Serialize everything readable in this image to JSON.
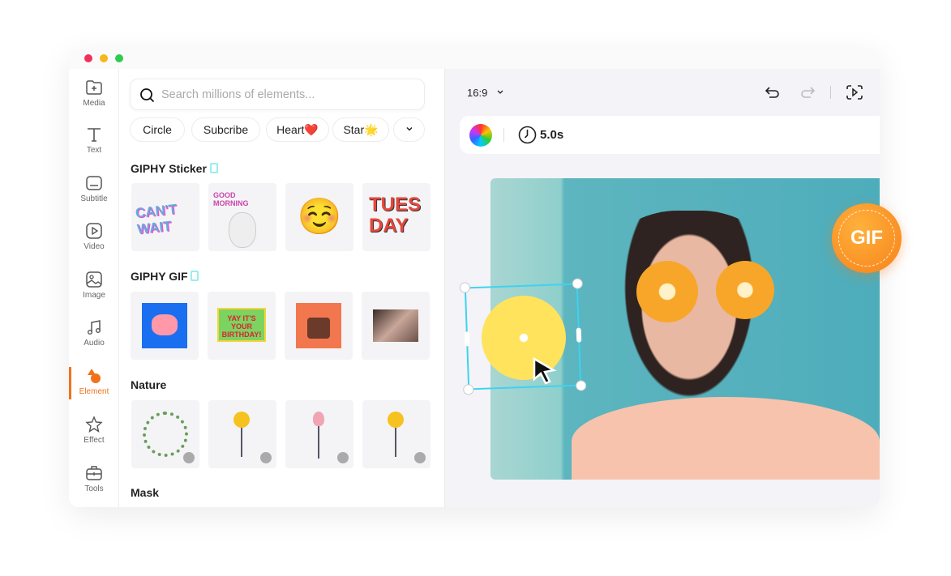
{
  "sidebar": {
    "items": [
      {
        "label": "Media",
        "icon": "folder-plus-icon"
      },
      {
        "label": "Text",
        "icon": "text-icon"
      },
      {
        "label": "Subtitle",
        "icon": "subtitle-icon"
      },
      {
        "label": "Video",
        "icon": "video-play-icon"
      },
      {
        "label": "Image",
        "icon": "image-icon"
      },
      {
        "label": "Audio",
        "icon": "music-note-icon"
      },
      {
        "label": "Element",
        "icon": "shapes-icon",
        "active": true
      },
      {
        "label": "Effect",
        "icon": "sparkle-icon"
      },
      {
        "label": "Tools",
        "icon": "toolbox-icon"
      }
    ]
  },
  "panel": {
    "search_placeholder": "Search millions of elements...",
    "chips": [
      "Circle",
      "Subcribe",
      "Heart❤️",
      "Star🌟"
    ],
    "sections": [
      {
        "title": "GIPHY Sticker",
        "tiles": [
          "CAN'T WAIT",
          "GOOD MORNING",
          "☺️",
          "TUES DAY"
        ]
      },
      {
        "title": "GIPHY GIF",
        "tiles": [
          "",
          "YAY IT'S YOUR BIRTHDAY!",
          "",
          ""
        ]
      },
      {
        "title": "Nature",
        "tiles": [
          "",
          "",
          "",
          ""
        ]
      },
      {
        "title": "Mask",
        "tiles": []
      }
    ]
  },
  "canvas": {
    "aspect_ratio": "16:9",
    "duration": "5.0s",
    "badge": "GIF"
  },
  "colors": {
    "accent": "#f0731c",
    "selection": "#3dd3f0"
  }
}
